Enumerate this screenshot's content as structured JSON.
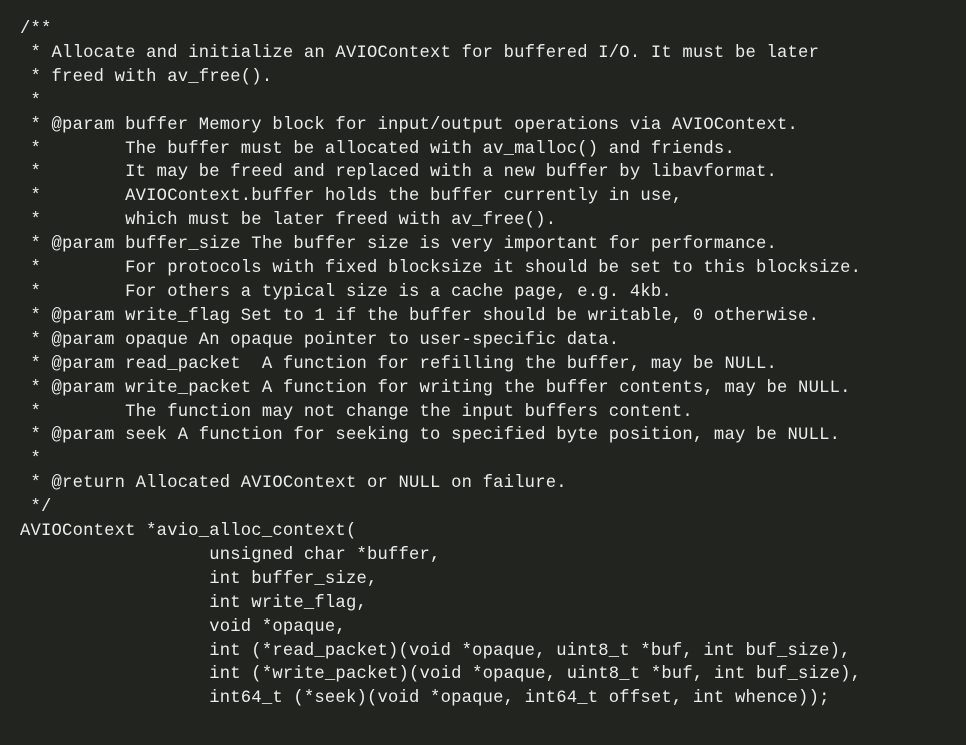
{
  "lines": [
    "/**",
    " * Allocate and initialize an AVIOContext for buffered I/O. It must be later",
    " * freed with av_free().",
    " *",
    " * @param buffer Memory block for input/output operations via AVIOContext.",
    " *        The buffer must be allocated with av_malloc() and friends.",
    " *        It may be freed and replaced with a new buffer by libavformat.",
    " *        AVIOContext.buffer holds the buffer currently in use,",
    " *        which must be later freed with av_free().",
    " * @param buffer_size The buffer size is very important for performance.",
    " *        For protocols with fixed blocksize it should be set to this blocksize.",
    " *        For others a typical size is a cache page, e.g. 4kb.",
    " * @param write_flag Set to 1 if the buffer should be writable, 0 otherwise.",
    " * @param opaque An opaque pointer to user-specific data.",
    " * @param read_packet  A function for refilling the buffer, may be NULL.",
    " * @param write_packet A function for writing the buffer contents, may be NULL.",
    " *        The function may not change the input buffers content.",
    " * @param seek A function for seeking to specified byte position, may be NULL.",
    " *",
    " * @return Allocated AVIOContext or NULL on failure.",
    " */",
    "AVIOContext *avio_alloc_context(",
    "                  unsigned char *buffer,",
    "                  int buffer_size,",
    "                  int write_flag,",
    "                  void *opaque,",
    "                  int (*read_packet)(void *opaque, uint8_t *buf, int buf_size),",
    "                  int (*write_packet)(void *opaque, uint8_t *buf, int buf_size),",
    "                  int64_t (*seek)(void *opaque, int64_t offset, int whence));"
  ]
}
